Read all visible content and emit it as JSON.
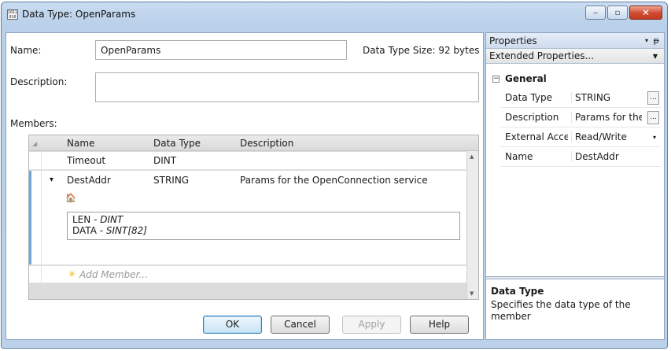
{
  "window": {
    "icon_text": "1011\n010",
    "title": "Data Type: OpenParams",
    "buttons": {
      "minimize": "‒",
      "maximize": "▫",
      "close": "✕"
    }
  },
  "form": {
    "name_label": "Name:",
    "name_value": "OpenParams",
    "data_type_size": "Data Type Size: 92 bytes",
    "description_label": "Description:",
    "description_value": "",
    "members_label": "Members:"
  },
  "members_table": {
    "columns": [
      "Name",
      "Data Type",
      "Description"
    ],
    "rows": [
      {
        "name": "Timeout",
        "data_type": "DINT",
        "description": ""
      },
      {
        "name": "DestAddr",
        "data_type": "STRING",
        "description": "Params for the OpenConnection service",
        "expander": "▾"
      }
    ],
    "struct_icon": "🏠",
    "struct_lines": [
      {
        "name": "LEN",
        "sep": " - ",
        "type": "DINT"
      },
      {
        "name": "DATA",
        "sep": " - ",
        "type": "SINT[82]"
      }
    ],
    "add_member_icon": "✳",
    "add_member_label": "Add Member..."
  },
  "dialog_buttons": {
    "ok": "OK",
    "cancel": "Cancel",
    "apply": "Apply",
    "help": "Help"
  },
  "properties": {
    "panel_title": "Properties",
    "panel_dropdown_icon": "▾",
    "pin_icon": "ᵽ",
    "selector": "Extended Properties...",
    "group_toggle": "−",
    "group_name": "General",
    "items": [
      {
        "name": "Data Type",
        "value": "STRING",
        "editor": "..."
      },
      {
        "name": "Description",
        "value": "Params for the",
        "editor": "..."
      },
      {
        "name": "External Acces",
        "value": "Read/Write",
        "editor": "▾"
      },
      {
        "name": "Name",
        "value": "DestAddr",
        "editor": ""
      }
    ],
    "help_title": "Data Type",
    "help_text": "Specifies the data type of the member"
  }
}
